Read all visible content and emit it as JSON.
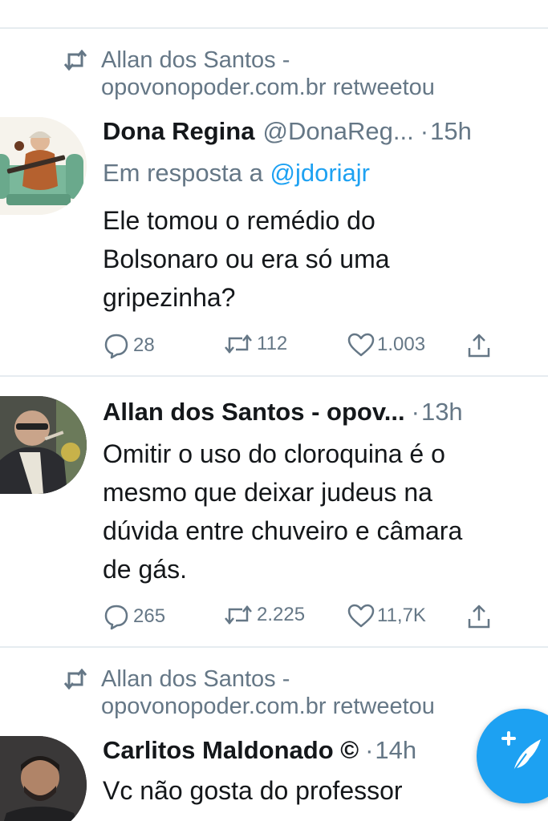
{
  "colors": {
    "accent": "#1da1f2",
    "secondary_text": "#657786",
    "separator": "#e6ecf0"
  },
  "tweets": [
    {
      "retweeted_by": "Allan dos Santos - opovonopoder.com.br retweetou",
      "retweeted_by_line1": "Allan dos Santos -",
      "retweeted_by_line2": "opovonopoder.com.br retweetou",
      "author_name": "Dona Regina",
      "author_handle": "@DonaReg...",
      "time": "15h",
      "reply_prefix": "Em resposta a ",
      "reply_handle": "@jdoriajr",
      "text": "Ele tomou o remédio do\nBolsonaro ou era só uma\ngripezinha?",
      "replies": "28",
      "retweets": "112",
      "likes": "1.003",
      "share_icon": "share-icon"
    },
    {
      "author_name": "Allan dos Santos - opov...",
      "time": "13h",
      "text": "Omitir o uso do cloroquina é o\nmesmo que deixar judeus na\ndúvida entre chuveiro e câmara\nde gás.",
      "replies": "265",
      "retweets": "2.225",
      "likes": "11,7K",
      "share_icon": "share-icon"
    },
    {
      "retweeted_by": "Allan dos Santos - opovonopoder.com.br retweetou",
      "retweeted_by_line1": "Allan dos Santos -",
      "retweeted_by_line2": "opovonopoder.com.br retweetou",
      "author_name": "Carlitos Maldonado ©",
      "time": "14h",
      "text": "Vc não gosta do professor"
    }
  ],
  "compose_button": {
    "icon": "compose-feather-icon"
  }
}
